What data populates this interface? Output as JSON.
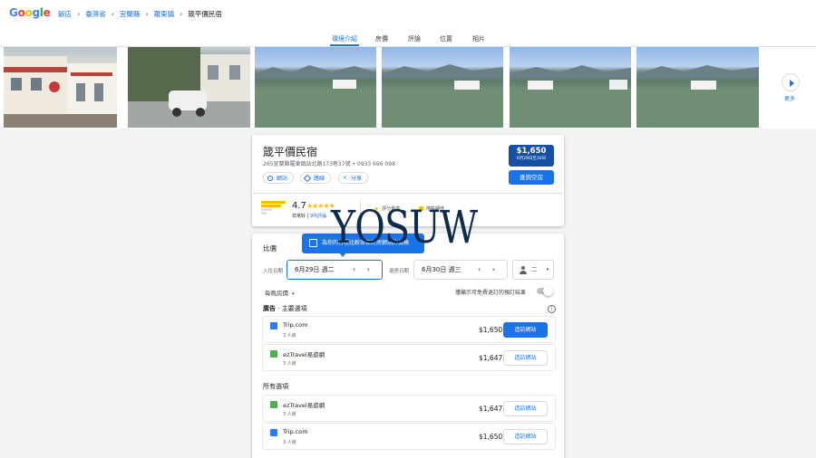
{
  "header": {
    "logo_letters": [
      "G",
      "o",
      "o",
      "g",
      "l",
      "e"
    ],
    "logo_colors": [
      "#4285f4",
      "#ea4335",
      "#fbbc04",
      "#4285f4",
      "#34a853",
      "#ea4335"
    ],
    "breadcrumbs": [
      "飯店",
      "臺灣省",
      "宜蘭縣",
      "羅東鎮",
      "箴平價民宿"
    ],
    "separator": "›"
  },
  "tabs": {
    "items": [
      "環境介紹",
      "房價",
      "評論",
      "位置",
      "相片"
    ],
    "active_index": 0
  },
  "photos": {
    "more_label": "更多"
  },
  "hotel": {
    "name": "箴平價民宿",
    "address_phone": "265宜蘭縣羅東鎮站北路173巷37號 • 0933 696 098",
    "actions": [
      "網站",
      "路線",
      "分享"
    ],
    "price": "$1,650",
    "price_dates": "6月29日至30日",
    "check_availability": "查詢空房",
    "rating": "4.7",
    "stars": "★★★★★",
    "rating_label": "非常好",
    "review_count": "9則評論",
    "badges": [
      "評分最高",
      "地點絕佳"
    ]
  },
  "pricing": {
    "title": "比價",
    "tooltip": "為你的行程比較各家訂房網站的價格",
    "checkin_label": "入住日期",
    "checkin_value": "6月29日 週二",
    "checkout_label": "退房日期",
    "checkout_value": "6月30日 週三",
    "nav_arrows": "‹ ›",
    "guests_value": "二",
    "sort_label": "每晚房價",
    "toggle_label": "僅顯示可免費退訂的預訂結果",
    "sponsored_prefix": "廣告",
    "sponsored_title": "主要選項",
    "all_title": "所有選項",
    "sponsored_offers": [
      {
        "name": "Trip.com",
        "room": "3 人房",
        "price": "$1,650",
        "button": "造訪網站",
        "primary": true,
        "color": "#287dfa"
      },
      {
        "name": "ezTravel易遊網",
        "room": "3 人房",
        "price": "$1,647",
        "button": "造訪網站",
        "primary": false,
        "color": "#4caf50"
      }
    ],
    "all_offers": [
      {
        "name": "ezTravel易遊網",
        "room": "3 人房",
        "price": "$1,647",
        "button": "造訪網站",
        "primary": false,
        "color": "#4caf50"
      },
      {
        "name": "Trip.com",
        "room": "3 人房",
        "price": "$1,650",
        "button": "造訪網站",
        "primary": false,
        "color": "#287dfa"
      }
    ]
  },
  "watermark": "YOSUW"
}
